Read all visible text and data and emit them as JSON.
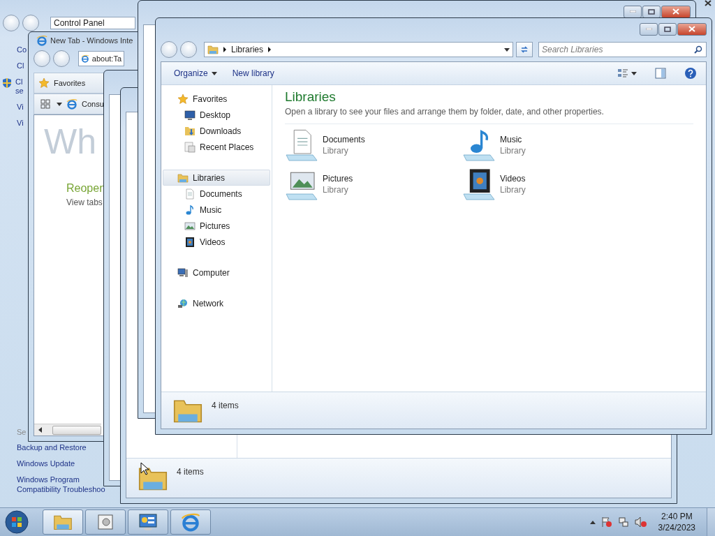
{
  "control_panel": {
    "address": "Control Panel",
    "tasks": [
      {
        "lines": [
          "Co"
        ],
        "shield": false
      },
      {
        "lines": [
          "Cl"
        ],
        "shield": false
      },
      {
        "lines": [
          "Cl",
          "se"
        ],
        "shield": true
      },
      {
        "lines": [
          "Vi"
        ],
        "shield": false
      },
      {
        "lines": [
          "Vi"
        ],
        "shield": false
      }
    ],
    "see_also": "Se",
    "links": [
      {
        "lines": [
          "Backup and Restore"
        ]
      },
      {
        "lines": [
          "Windows Update"
        ]
      },
      {
        "lines": [
          "Windows Program",
          "Compatibility Troubleshoo"
        ]
      }
    ]
  },
  "browser": {
    "title": "New Tab - Windows Inte",
    "address": "about:Ta",
    "favorites": "Favorites",
    "tab": "Consu",
    "watermark": "Wh",
    "heading": "Reopen",
    "link": "View tabs"
  },
  "back_explorer": {
    "status": "4 items"
  },
  "explorer": {
    "breadcrumb": [
      "Libraries"
    ],
    "search": {
      "placeholder": "Search Libraries"
    },
    "commands": [
      {
        "label": "Organize",
        "menu": true
      },
      {
        "label": "New library",
        "menu": false
      }
    ],
    "nav": [
      {
        "label": "Favorites",
        "selected": false,
        "children": [
          {
            "label": "Desktop",
            "selected": false
          },
          {
            "label": "Downloads",
            "selected": false
          },
          {
            "label": "Recent Places",
            "selected": false
          }
        ]
      },
      {
        "label": "Libraries",
        "selected": true,
        "children": [
          {
            "label": "Documents",
            "selected": false
          },
          {
            "label": "Music",
            "selected": false
          },
          {
            "label": "Pictures",
            "selected": false
          },
          {
            "label": "Videos",
            "selected": false
          }
        ]
      },
      {
        "label": "Computer",
        "selected": false
      },
      {
        "label": "Network",
        "selected": false
      }
    ],
    "heading": "Libraries",
    "description": "Open a library to see your files and arrange them by folder, date, and other properties.",
    "libraries": [
      {
        "name": "Documents",
        "type": "Library"
      },
      {
        "name": "Music",
        "type": "Library"
      },
      {
        "name": "Pictures",
        "type": "Library"
      },
      {
        "name": "Videos",
        "type": "Library"
      }
    ],
    "status": "4 items"
  },
  "taskbar": {
    "time": "2:40 PM",
    "date": "3/24/2023"
  }
}
